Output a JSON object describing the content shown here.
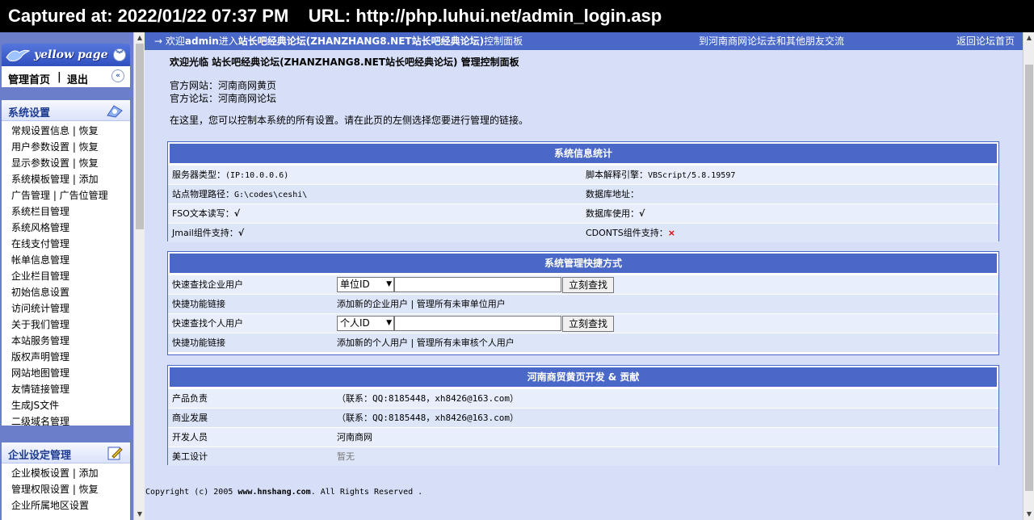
{
  "capture": {
    "label": "Captured at: 2022/01/22 07:37 PM    URL: http://php.luhui.net/admin_login.asp"
  },
  "sidebar": {
    "logo": "yellow page",
    "nav_home": "管理首页",
    "nav_sep": "|",
    "nav_logout": "退出",
    "groups": [
      {
        "title": "系统设置",
        "items": [
          "常规设置信息 | 恢复",
          "用户参数设置 | 恢复",
          "显示参数设置 | 恢复",
          "系统模板管理 | 添加",
          "广告管理 | 广告位管理",
          "系统栏目管理",
          "系统风格管理",
          "在线支付管理",
          "帐单信息管理",
          "企业栏目管理",
          "初始信息设置",
          "访问统计管理",
          "关于我们管理",
          "本站服务管理",
          "版权声明管理",
          "网站地图管理",
          "友情链接管理",
          "生成JS文件",
          "二级域名管理"
        ]
      },
      {
        "title": "企业设定管理",
        "items": [
          "企业模板设置 | 添加",
          "管理权限设置 | 恢复",
          "企业所属地区设置"
        ]
      }
    ]
  },
  "topbar": {
    "arrow": "→",
    "welcome_pre": "欢迎",
    "user": "admin",
    "welcome_mid": "进入",
    "forum": "站长吧经典论坛(ZHANZHANG8.NET站长吧经典论坛)",
    "welcome_post": "控制面板",
    "middle_link": "到河南商网论坛去和其他朋友交流",
    "right_link": "返回论坛首页"
  },
  "main": {
    "welcome": "欢迎光临 站长吧经典论坛(ZHANZHANG8.NET站长吧经典论坛) 管理控制面板",
    "site": "官方网站：河南商网黄页",
    "forum": "官方论坛：河南商网论坛",
    "intro": "在这里，您可以控制本系统的所有设置。请在此页的左侧选择您要进行管理的链接。"
  },
  "stats": {
    "title": "系统信息统计",
    "rows": [
      {
        "l_label": "服务器类型：",
        "l_value": "(IP:10.0.0.6)",
        "r_label": "脚本解释引擎：",
        "r_value": "VBScript/5.8.19597"
      },
      {
        "l_label": "站点物理路径：",
        "l_value": "G:\\codes\\ceshi\\",
        "r_label": "数据库地址：",
        "r_value": ""
      },
      {
        "l_label": "FSO文本读写：",
        "l_value": "√",
        "r_label": "数据库使用：",
        "r_value": "√"
      },
      {
        "l_label": "Jmail组件支持：",
        "l_value": "√",
        "r_label": "CDONTS组件支持：",
        "r_value": "×"
      }
    ]
  },
  "shortcuts": {
    "title": "系统管理快捷方式",
    "row1_label": "快速查找企业用户",
    "row1_select": "单位ID",
    "row1_button": "立刻查找",
    "row2_label": "快捷功能链接",
    "row2_link1": "添加新的企业用户",
    "row2_sep": "|",
    "row2_link2": "管理所有未审单位用户",
    "row3_label": "快速查找个人用户",
    "row3_select": "个人ID",
    "row3_button": "立刻查找",
    "row4_label": "快捷功能链接",
    "row4_link1": "添加新的个人用户",
    "row4_sep": "|",
    "row4_link2": "管理所有未审核个人用户"
  },
  "credits": {
    "title": "河南商贸黄页开发 & 贡献",
    "rows": [
      {
        "label": "产品负责",
        "value": "（联系：QQ:8185448，xh8426@163.com）"
      },
      {
        "label": "商业发展",
        "value": "（联系：QQ:8185448，xh8426@163.com）"
      },
      {
        "label": "开发人员",
        "value": "河南商网"
      },
      {
        "label": "美工设计",
        "value": "暂无"
      }
    ]
  },
  "footer": {
    "pre": "Copyright (c) 2005 ",
    "site": "www.hnshang.com",
    "post": ". All Rights Reserved ."
  }
}
